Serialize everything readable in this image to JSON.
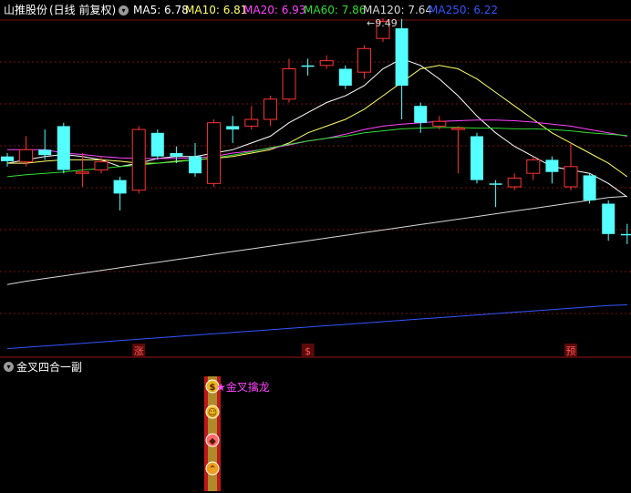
{
  "header": {
    "stock_name": "山推股份",
    "period": "(日线 前复权)",
    "ma_labels": [
      {
        "text": "MA5: 6.78",
        "color": "#ffffff"
      },
      {
        "text": "MA10: 6.81",
        "color": "#ffff66"
      },
      {
        "text": "MA20: 6.93",
        "color": "#ff44ff"
      },
      {
        "text": "MA60: 7.86",
        "color": "#33dd33"
      },
      {
        "text": "MA120: 7.64",
        "color": "#d8d8d8"
      },
      {
        "text": "MA250: 6.22",
        "color": "#3355ff"
      }
    ]
  },
  "indicator": {
    "title": "金叉四合一副",
    "signal_label": "★金叉擒龙",
    "signal_color": "#ff44ff",
    "icons": [
      "dollar-icon",
      "smiley-icon",
      "diamond-icon",
      "chevron-up-icon"
    ]
  },
  "chart_data": {
    "type": "candlestick",
    "y_range": [
      4.5,
      9.5
    ],
    "up_color": "#ff3333",
    "down_color": "#54ffff",
    "high_annotation": "9.49",
    "markers": [
      {
        "text": "涨",
        "candle_index": 7
      },
      {
        "text": "$",
        "candle_index": 16
      },
      {
        "text": "预",
        "candle_index": 30
      }
    ],
    "candles": [
      {
        "o": 7.45,
        "h": 7.5,
        "c": 7.38,
        "l": 7.3
      },
      {
        "o": 7.37,
        "h": 7.75,
        "c": 7.55,
        "l": 7.3
      },
      {
        "o": 7.55,
        "h": 7.85,
        "c": 7.47,
        "l": 7.4
      },
      {
        "o": 7.9,
        "h": 7.95,
        "c": 7.25,
        "l": 7.2
      },
      {
        "o": 7.2,
        "h": 7.5,
        "c": 7.22,
        "l": 7.0
      },
      {
        "o": 7.25,
        "h": 7.45,
        "c": 7.37,
        "l": 7.2
      },
      {
        "o": 7.1,
        "h": 7.15,
        "c": 6.9,
        "l": 6.65
      },
      {
        "o": 6.95,
        "h": 7.9,
        "c": 7.85,
        "l": 6.9
      },
      {
        "o": 7.8,
        "h": 7.85,
        "c": 7.45,
        "l": 7.4
      },
      {
        "o": 7.5,
        "h": 7.6,
        "c": 7.45,
        "l": 7.35
      },
      {
        "o": 7.45,
        "h": 7.65,
        "c": 7.2,
        "l": 7.15
      },
      {
        "o": 7.05,
        "h": 8.0,
        "c": 7.95,
        "l": 7.0
      },
      {
        "o": 7.9,
        "h": 8.05,
        "c": 7.85,
        "l": 7.65
      },
      {
        "o": 7.9,
        "h": 8.2,
        "c": 8.0,
        "l": 7.85
      },
      {
        "o": 8.0,
        "h": 8.35,
        "c": 8.3,
        "l": 7.9
      },
      {
        "o": 8.3,
        "h": 8.9,
        "c": 8.75,
        "l": 8.25
      },
      {
        "o": 8.8,
        "h": 8.9,
        "c": 8.78,
        "l": 8.65
      },
      {
        "o": 8.8,
        "h": 8.95,
        "c": 8.87,
        "l": 8.75
      },
      {
        "o": 8.75,
        "h": 8.8,
        "c": 8.5,
        "l": 8.45
      },
      {
        "o": 8.7,
        "h": 9.1,
        "c": 9.05,
        "l": 8.6
      },
      {
        "o": 9.2,
        "h": 9.5,
        "c": 9.45,
        "l": 9.15
      },
      {
        "o": 9.35,
        "h": 9.49,
        "c": 8.5,
        "l": 8.0
      },
      {
        "o": 8.2,
        "h": 8.25,
        "c": 7.95,
        "l": 7.8
      },
      {
        "o": 7.9,
        "h": 8.05,
        "c": 7.97,
        "l": 7.85
      },
      {
        "o": 7.85,
        "h": 7.9,
        "c": 7.87,
        "l": 7.2
      },
      {
        "o": 7.75,
        "h": 7.8,
        "c": 7.1,
        "l": 7.05
      },
      {
        "o": 7.05,
        "h": 7.1,
        "c": 7.03,
        "l": 6.7
      },
      {
        "o": 7.0,
        "h": 7.2,
        "c": 7.13,
        "l": 6.95
      },
      {
        "o": 7.2,
        "h": 7.45,
        "c": 7.4,
        "l": 7.1
      },
      {
        "o": 7.4,
        "h": 7.45,
        "c": 7.22,
        "l": 7.05
      },
      {
        "o": 7.0,
        "h": 7.65,
        "c": 7.3,
        "l": 6.95
      },
      {
        "o": 7.17,
        "h": 7.2,
        "c": 6.8,
        "l": 6.75
      },
      {
        "o": 6.75,
        "h": 6.8,
        "c": 6.3,
        "l": 6.2
      },
      {
        "o": 6.3,
        "h": 6.45,
        "c": 6.28,
        "l": 6.15
      }
    ],
    "ma_lines": [
      {
        "name": "MA5",
        "color": "#ffffff",
        "values": [
          7.35,
          7.4,
          7.45,
          7.48,
          7.45,
          7.4,
          7.3,
          7.35,
          7.42,
          7.45,
          7.45,
          7.5,
          7.55,
          7.65,
          7.75,
          7.95,
          8.1,
          8.25,
          8.35,
          8.5,
          8.75,
          8.9,
          8.8,
          8.6,
          8.35,
          8.05,
          7.8,
          7.6,
          7.45,
          7.3,
          7.25,
          7.2,
          7.05,
          6.85
        ]
      },
      {
        "name": "MA10",
        "color": "#ffff66",
        "values": [
          7.35,
          7.35,
          7.38,
          7.4,
          7.4,
          7.4,
          7.38,
          7.35,
          7.35,
          7.38,
          7.4,
          7.42,
          7.45,
          7.5,
          7.55,
          7.65,
          7.8,
          7.9,
          8.0,
          8.15,
          8.35,
          8.55,
          8.75,
          8.8,
          8.75,
          8.6,
          8.4,
          8.2,
          8.0,
          7.8,
          7.65,
          7.5,
          7.35,
          7.15
        ]
      },
      {
        "name": "MA20",
        "color": "#ff44ff",
        "values": [
          7.55,
          7.55,
          7.55,
          7.5,
          7.48,
          7.45,
          7.43,
          7.42,
          7.42,
          7.42,
          7.43,
          7.45,
          7.5,
          7.53,
          7.57,
          7.62,
          7.68,
          7.72,
          7.78,
          7.85,
          7.9,
          7.93,
          7.95,
          7.97,
          7.98,
          7.99,
          7.99,
          7.98,
          7.96,
          7.93,
          7.9,
          7.85,
          7.8,
          7.75
        ]
      },
      {
        "name": "MA60",
        "color": "#33dd33",
        "values": [
          7.15,
          7.18,
          7.2,
          7.22,
          7.25,
          7.27,
          7.3,
          7.32,
          7.35,
          7.37,
          7.4,
          7.43,
          7.47,
          7.52,
          7.58,
          7.63,
          7.68,
          7.72,
          7.75,
          7.8,
          7.83,
          7.86,
          7.87,
          7.88,
          7.88,
          7.87,
          7.87,
          7.86,
          7.86,
          7.85,
          7.83,
          7.8,
          7.78,
          7.76
        ]
      },
      {
        "name": "MA120",
        "color": "#d8d8d8",
        "values": [
          5.55,
          5.6,
          5.64,
          5.68,
          5.72,
          5.76,
          5.8,
          5.84,
          5.88,
          5.92,
          5.96,
          6.0,
          6.04,
          6.08,
          6.12,
          6.16,
          6.2,
          6.24,
          6.28,
          6.32,
          6.36,
          6.4,
          6.44,
          6.48,
          6.52,
          6.56,
          6.6,
          6.64,
          6.68,
          6.72,
          6.76,
          6.8,
          6.84,
          6.86
        ]
      },
      {
        "name": "MA250",
        "color": "#3355ff",
        "values": [
          4.6,
          4.62,
          4.64,
          4.66,
          4.68,
          4.7,
          4.72,
          4.74,
          4.76,
          4.78,
          4.8,
          4.82,
          4.84,
          4.86,
          4.88,
          4.9,
          4.92,
          4.94,
          4.96,
          4.98,
          5.0,
          5.02,
          5.04,
          5.06,
          5.08,
          5.1,
          5.12,
          5.14,
          5.16,
          5.18,
          5.2,
          5.22,
          5.24,
          5.25
        ]
      }
    ]
  }
}
